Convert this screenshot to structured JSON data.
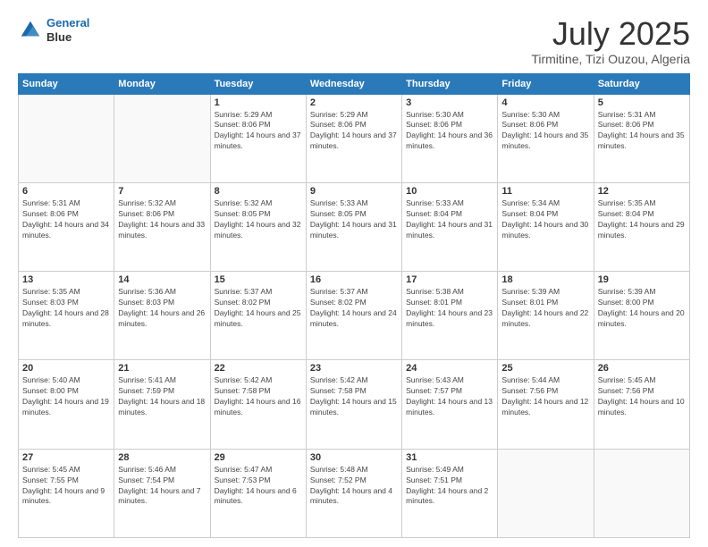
{
  "logo": {
    "line1": "General",
    "line2": "Blue"
  },
  "title": "July 2025",
  "subtitle": "Tirmitine, Tizi Ouzou, Algeria",
  "weekdays": [
    "Sunday",
    "Monday",
    "Tuesday",
    "Wednesday",
    "Thursday",
    "Friday",
    "Saturday"
  ],
  "weeks": [
    [
      {
        "day": "",
        "sunrise": "",
        "sunset": "",
        "daylight": ""
      },
      {
        "day": "",
        "sunrise": "",
        "sunset": "",
        "daylight": ""
      },
      {
        "day": "1",
        "sunrise": "Sunrise: 5:29 AM",
        "sunset": "Sunset: 8:06 PM",
        "daylight": "Daylight: 14 hours and 37 minutes."
      },
      {
        "day": "2",
        "sunrise": "Sunrise: 5:29 AM",
        "sunset": "Sunset: 8:06 PM",
        "daylight": "Daylight: 14 hours and 37 minutes."
      },
      {
        "day": "3",
        "sunrise": "Sunrise: 5:30 AM",
        "sunset": "Sunset: 8:06 PM",
        "daylight": "Daylight: 14 hours and 36 minutes."
      },
      {
        "day": "4",
        "sunrise": "Sunrise: 5:30 AM",
        "sunset": "Sunset: 8:06 PM",
        "daylight": "Daylight: 14 hours and 35 minutes."
      },
      {
        "day": "5",
        "sunrise": "Sunrise: 5:31 AM",
        "sunset": "Sunset: 8:06 PM",
        "daylight": "Daylight: 14 hours and 35 minutes."
      }
    ],
    [
      {
        "day": "6",
        "sunrise": "Sunrise: 5:31 AM",
        "sunset": "Sunset: 8:06 PM",
        "daylight": "Daylight: 14 hours and 34 minutes."
      },
      {
        "day": "7",
        "sunrise": "Sunrise: 5:32 AM",
        "sunset": "Sunset: 8:06 PM",
        "daylight": "Daylight: 14 hours and 33 minutes."
      },
      {
        "day": "8",
        "sunrise": "Sunrise: 5:32 AM",
        "sunset": "Sunset: 8:05 PM",
        "daylight": "Daylight: 14 hours and 32 minutes."
      },
      {
        "day": "9",
        "sunrise": "Sunrise: 5:33 AM",
        "sunset": "Sunset: 8:05 PM",
        "daylight": "Daylight: 14 hours and 31 minutes."
      },
      {
        "day": "10",
        "sunrise": "Sunrise: 5:33 AM",
        "sunset": "Sunset: 8:04 PM",
        "daylight": "Daylight: 14 hours and 31 minutes."
      },
      {
        "day": "11",
        "sunrise": "Sunrise: 5:34 AM",
        "sunset": "Sunset: 8:04 PM",
        "daylight": "Daylight: 14 hours and 30 minutes."
      },
      {
        "day": "12",
        "sunrise": "Sunrise: 5:35 AM",
        "sunset": "Sunset: 8:04 PM",
        "daylight": "Daylight: 14 hours and 29 minutes."
      }
    ],
    [
      {
        "day": "13",
        "sunrise": "Sunrise: 5:35 AM",
        "sunset": "Sunset: 8:03 PM",
        "daylight": "Daylight: 14 hours and 28 minutes."
      },
      {
        "day": "14",
        "sunrise": "Sunrise: 5:36 AM",
        "sunset": "Sunset: 8:03 PM",
        "daylight": "Daylight: 14 hours and 26 minutes."
      },
      {
        "day": "15",
        "sunrise": "Sunrise: 5:37 AM",
        "sunset": "Sunset: 8:02 PM",
        "daylight": "Daylight: 14 hours and 25 minutes."
      },
      {
        "day": "16",
        "sunrise": "Sunrise: 5:37 AM",
        "sunset": "Sunset: 8:02 PM",
        "daylight": "Daylight: 14 hours and 24 minutes."
      },
      {
        "day": "17",
        "sunrise": "Sunrise: 5:38 AM",
        "sunset": "Sunset: 8:01 PM",
        "daylight": "Daylight: 14 hours and 23 minutes."
      },
      {
        "day": "18",
        "sunrise": "Sunrise: 5:39 AM",
        "sunset": "Sunset: 8:01 PM",
        "daylight": "Daylight: 14 hours and 22 minutes."
      },
      {
        "day": "19",
        "sunrise": "Sunrise: 5:39 AM",
        "sunset": "Sunset: 8:00 PM",
        "daylight": "Daylight: 14 hours and 20 minutes."
      }
    ],
    [
      {
        "day": "20",
        "sunrise": "Sunrise: 5:40 AM",
        "sunset": "Sunset: 8:00 PM",
        "daylight": "Daylight: 14 hours and 19 minutes."
      },
      {
        "day": "21",
        "sunrise": "Sunrise: 5:41 AM",
        "sunset": "Sunset: 7:59 PM",
        "daylight": "Daylight: 14 hours and 18 minutes."
      },
      {
        "day": "22",
        "sunrise": "Sunrise: 5:42 AM",
        "sunset": "Sunset: 7:58 PM",
        "daylight": "Daylight: 14 hours and 16 minutes."
      },
      {
        "day": "23",
        "sunrise": "Sunrise: 5:42 AM",
        "sunset": "Sunset: 7:58 PM",
        "daylight": "Daylight: 14 hours and 15 minutes."
      },
      {
        "day": "24",
        "sunrise": "Sunrise: 5:43 AM",
        "sunset": "Sunset: 7:57 PM",
        "daylight": "Daylight: 14 hours and 13 minutes."
      },
      {
        "day": "25",
        "sunrise": "Sunrise: 5:44 AM",
        "sunset": "Sunset: 7:56 PM",
        "daylight": "Daylight: 14 hours and 12 minutes."
      },
      {
        "day": "26",
        "sunrise": "Sunrise: 5:45 AM",
        "sunset": "Sunset: 7:56 PM",
        "daylight": "Daylight: 14 hours and 10 minutes."
      }
    ],
    [
      {
        "day": "27",
        "sunrise": "Sunrise: 5:45 AM",
        "sunset": "Sunset: 7:55 PM",
        "daylight": "Daylight: 14 hours and 9 minutes."
      },
      {
        "day": "28",
        "sunrise": "Sunrise: 5:46 AM",
        "sunset": "Sunset: 7:54 PM",
        "daylight": "Daylight: 14 hours and 7 minutes."
      },
      {
        "day": "29",
        "sunrise": "Sunrise: 5:47 AM",
        "sunset": "Sunset: 7:53 PM",
        "daylight": "Daylight: 14 hours and 6 minutes."
      },
      {
        "day": "30",
        "sunrise": "Sunrise: 5:48 AM",
        "sunset": "Sunset: 7:52 PM",
        "daylight": "Daylight: 14 hours and 4 minutes."
      },
      {
        "day": "31",
        "sunrise": "Sunrise: 5:49 AM",
        "sunset": "Sunset: 7:51 PM",
        "daylight": "Daylight: 14 hours and 2 minutes."
      },
      {
        "day": "",
        "sunrise": "",
        "sunset": "",
        "daylight": ""
      },
      {
        "day": "",
        "sunrise": "",
        "sunset": "",
        "daylight": ""
      }
    ]
  ]
}
